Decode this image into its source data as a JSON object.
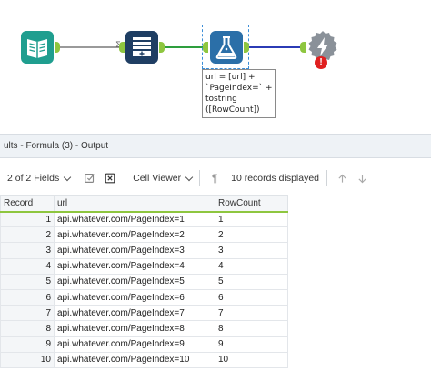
{
  "canvas": {
    "annotation_lines": [
      "url = [url] +",
      "`PageIndex=` +",
      "tostring",
      "([RowCount])"
    ],
    "colors": {
      "anchor": "#8ec63f",
      "connector_gray": "#9a9a9a",
      "connector_green": "#2e9e3e",
      "connector_blue": "#2b3bb5",
      "tool_teal": "#1f9e8f",
      "tool_navy": "#1f3e63",
      "tool_blue": "#2b6fa8",
      "tool_gray": "#8a9199",
      "error_red": "#e02020"
    },
    "tools": [
      "input-data-icon",
      "generate-rows-icon",
      "formula-icon",
      "download-icon"
    ]
  },
  "results": {
    "title": "ults - Formula (3) - Output"
  },
  "toolbar": {
    "fields_label": "2 of 2 Fields",
    "cell_viewer_label": "Cell Viewer",
    "records_label": "10 records displayed"
  },
  "table": {
    "headers": [
      "Record",
      "url",
      "RowCount"
    ],
    "rows": [
      [
        "1",
        "api.whatever.com/PageIndex=1",
        "1"
      ],
      [
        "2",
        "api.whatever.com/PageIndex=2",
        "2"
      ],
      [
        "3",
        "api.whatever.com/PageIndex=3",
        "3"
      ],
      [
        "4",
        "api.whatever.com/PageIndex=4",
        "4"
      ],
      [
        "5",
        "api.whatever.com/PageIndex=5",
        "5"
      ],
      [
        "6",
        "api.whatever.com/PageIndex=6",
        "6"
      ],
      [
        "7",
        "api.whatever.com/PageIndex=7",
        "7"
      ],
      [
        "8",
        "api.whatever.com/PageIndex=8",
        "8"
      ],
      [
        "9",
        "api.whatever.com/PageIndex=9",
        "9"
      ],
      [
        "10",
        "api.whatever.com/PageIndex=10",
        "10"
      ]
    ]
  }
}
